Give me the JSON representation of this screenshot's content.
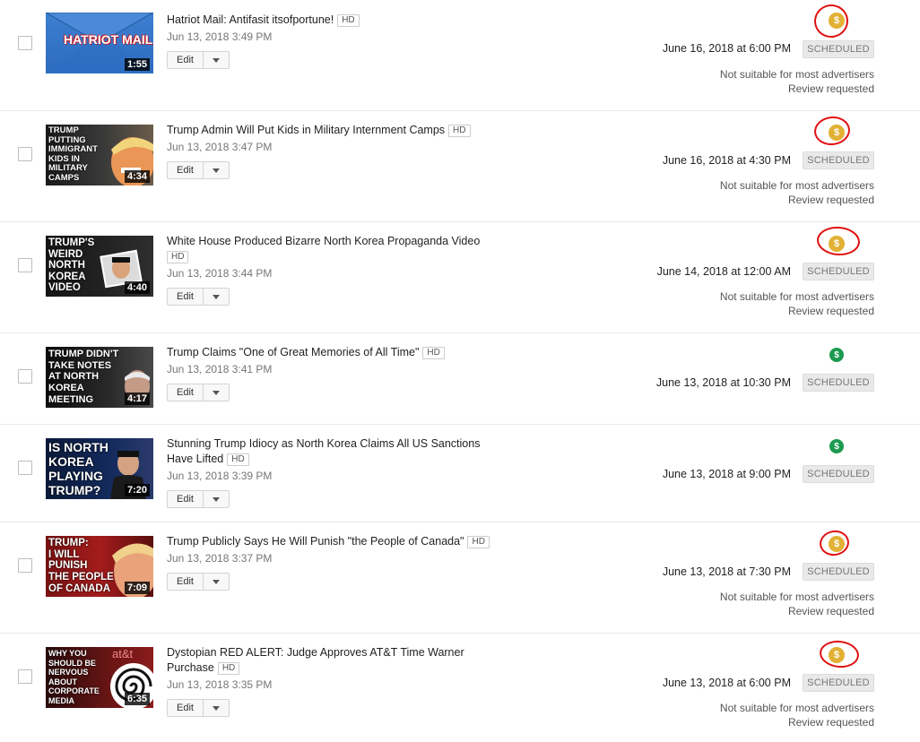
{
  "videos": [
    {
      "title": "Hatriot Mail: Antifasit itsofportune!",
      "hd": "HD",
      "uploaded": "Jun 13, 2018 3:49 PM",
      "duration": "1:55",
      "thumb_text": "HATRIOT MAIL",
      "scheduled": "June 16, 2018 at 6:00 PM",
      "status": "SCHEDULED",
      "monetization": "yellow",
      "ad_note": "Not suitable for most advertisers",
      "review": "Review requested",
      "edit": "Edit"
    },
    {
      "title": "Trump Admin Will Put Kids in Military Internment Camps",
      "hd": "HD",
      "uploaded": "Jun 13, 2018 3:47 PM",
      "duration": "4:34",
      "thumb_text": "TRUMP\nPUTTING\nIMMIGRANT\nKIDS IN\nMILITARY\nCAMPS",
      "scheduled": "June 16, 2018 at 4:30 PM",
      "status": "SCHEDULED",
      "monetization": "yellow",
      "ad_note": "Not suitable for most advertisers",
      "review": "Review requested",
      "edit": "Edit"
    },
    {
      "title": "White House Produced Bizarre North Korea Propaganda Video",
      "hd": "HD",
      "uploaded": "Jun 13, 2018 3:44 PM",
      "duration": "4:40",
      "thumb_text": "TRUMP'S\nWEIRD\nNORTH\nKOREA\nVIDEO",
      "scheduled": "June 14, 2018 at 12:00 AM",
      "status": "SCHEDULED",
      "monetization": "yellow",
      "ad_note": "Not suitable for most advertisers",
      "review": "Review requested",
      "edit": "Edit"
    },
    {
      "title": "Trump Claims \"One of Great Memories of All Time\"",
      "hd": "HD",
      "uploaded": "Jun 13, 2018 3:41 PM",
      "duration": "4:17",
      "thumb_text": "TRUMP DIDN'T\nTAKE NOTES\nAT NORTH\nKOREA\nMEETING",
      "scheduled": "June 13, 2018 at 10:30 PM",
      "status": "SCHEDULED",
      "monetization": "green",
      "ad_note": "",
      "review": "",
      "edit": "Edit"
    },
    {
      "title": "Stunning Trump Idiocy as North Korea Claims All US Sanctions Have Lifted",
      "hd": "HD",
      "uploaded": "Jun 13, 2018 3:39 PM",
      "duration": "7:20",
      "thumb_text": "IS NORTH\nKOREA\nPLAYING\nTRUMP?",
      "scheduled": "June 13, 2018 at 9:00 PM",
      "status": "SCHEDULED",
      "monetization": "green",
      "ad_note": "",
      "review": "",
      "edit": "Edit"
    },
    {
      "title": "Trump Publicly Says He Will Punish \"the People of Canada\"",
      "hd": "HD",
      "uploaded": "Jun 13, 2018 3:37 PM",
      "duration": "7:09",
      "thumb_text": "TRUMP:\nI WILL\nPUNISH\nTHE PEOPLE\nOF CANADA",
      "scheduled": "June 13, 2018 at 7:30 PM",
      "status": "SCHEDULED",
      "monetization": "yellow",
      "ad_note": "Not suitable for most advertisers",
      "review": "Review requested",
      "edit": "Edit"
    },
    {
      "title": "Dystopian RED ALERT: Judge Approves AT&T Time Warner Purchase",
      "hd": "HD",
      "uploaded": "Jun 13, 2018 3:35 PM",
      "duration": "6:35",
      "thumb_text": "WHY YOU\nSHOULD BE\nNERVOUS\nABOUT\nCORPORATE\nMEDIA",
      "thumb_brand": "at&t",
      "scheduled": "June 13, 2018 at 6:00 PM",
      "status": "SCHEDULED",
      "monetization": "yellow",
      "ad_note": "Not suitable for most advertisers",
      "review": "Review requested",
      "edit": "Edit"
    }
  ],
  "icons": {
    "monetization": "dollar-icon",
    "dropdown": "chevron-down-icon"
  },
  "colors": {
    "monetization_limited": "#e2b135",
    "monetization_on": "#1c9a50",
    "annotation": "#e01010",
    "status_badge_bg": "#e9e9e9"
  }
}
